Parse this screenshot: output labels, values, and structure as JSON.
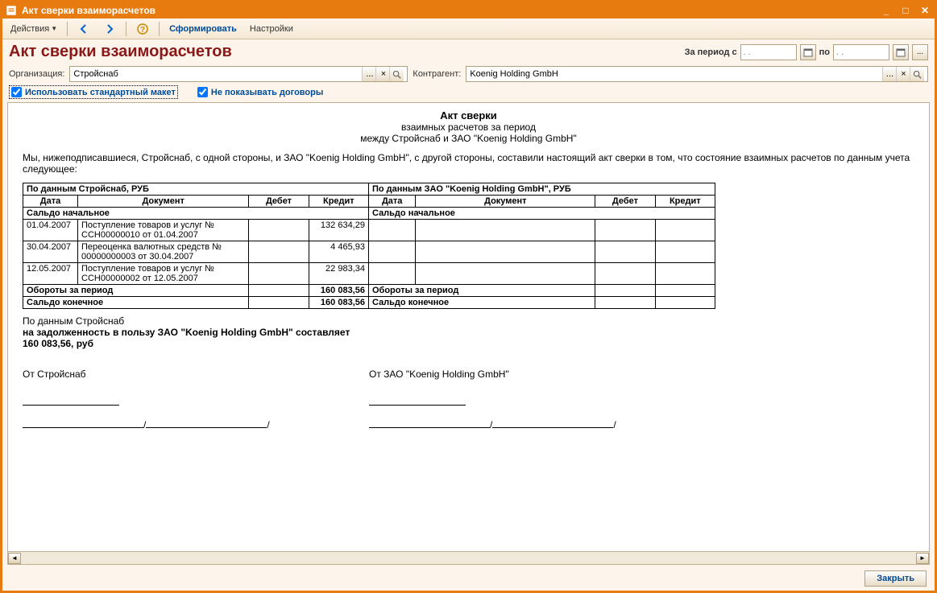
{
  "window": {
    "title": "Акт сверки взаиморасчетов"
  },
  "toolbar": {
    "actions": "Действия",
    "form": "Сформировать",
    "settings": "Настройки"
  },
  "header": {
    "title": "Акт сверки взаиморасчетов",
    "period_from_lbl": "За период с",
    "period_to_lbl": "по",
    "period_from": " . .",
    "period_to": " . ."
  },
  "filters": {
    "org_lbl": "Организация:",
    "org_val": "Стройснаб",
    "contr_lbl": "Контрагент:",
    "contr_val": "Koenig Holding GmbH"
  },
  "checks": {
    "use_standard": "Использовать стандартный макет",
    "hide_contracts": "Не показывать договоры"
  },
  "doc": {
    "title": "Акт сверки",
    "subtitle1": "взаимных расчетов за период",
    "subtitle2": "между Стройснаб и ЗАО \"Koenig Holding GmbH\"",
    "intro": "Мы, нижеподписавшиеся, Стройснаб, с одной стороны, и ЗАО \"Koenig Holding GmbH\", с другой стороны, составили настоящий акт сверки в том, что состояние взаимных расчетов по данным учета следующее:",
    "left_header": "По данным Стройснаб, РУБ",
    "right_header": "По данным ЗАО \"Koenig Holding GmbH\", РУБ",
    "col_date": "Дата",
    "col_doc": "Документ",
    "col_debit": "Дебет",
    "col_credit": "Кредит",
    "saldo_start": "Сальдо начальное",
    "rows": [
      {
        "date": "01.04.2007",
        "doc": "Поступление товаров и услуг № ССН00000010 от 01.04.2007",
        "debit": "",
        "credit": "132 634,29"
      },
      {
        "date": "30.04.2007",
        "doc": "Переоценка валютных средств № 00000000003 от 30.04.2007",
        "debit": "",
        "credit": "4 465,93"
      },
      {
        "date": "12.05.2007",
        "doc": "Поступление товаров и услуг № ССН00000002 от 12.05.2007",
        "debit": "",
        "credit": "22 983,34"
      }
    ],
    "turnover_lbl": "Обороты за период",
    "turnover_credit": "160 083,56",
    "saldo_end": "Сальдо конечное",
    "saldo_end_credit": "160 083,56",
    "summary1": "По данным Стройснаб",
    "summary2": "на  задолженность в пользу ЗАО \"Koenig Holding GmbH\" составляет",
    "summary3": "160 083,56, руб",
    "from_left": "От Стройснаб",
    "from_right": "От ЗАО \"Koenig Holding GmbH\""
  },
  "footer": {
    "close": "Закрыть"
  }
}
